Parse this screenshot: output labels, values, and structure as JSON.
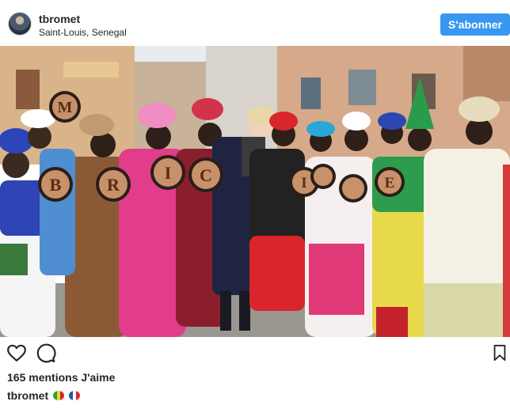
{
  "header": {
    "username": "tbromet",
    "location": "Saint-Louis, Senegal",
    "follow_label": "S'abonner"
  },
  "photo": {
    "sign_letters": [
      "M",
      "B",
      "R",
      "I",
      "C",
      "I",
      "E"
    ]
  },
  "actions": {
    "like_icon": "heart-icon",
    "comment_icon": "comment-icon",
    "save_icon": "bookmark-icon"
  },
  "likes_text": "165 mentions J'aime",
  "caption": {
    "username": "tbromet",
    "flags": [
      "senegal-flag",
      "france-flag"
    ]
  },
  "colors": {
    "follow_button": "#3897f0",
    "text": "#262626"
  }
}
